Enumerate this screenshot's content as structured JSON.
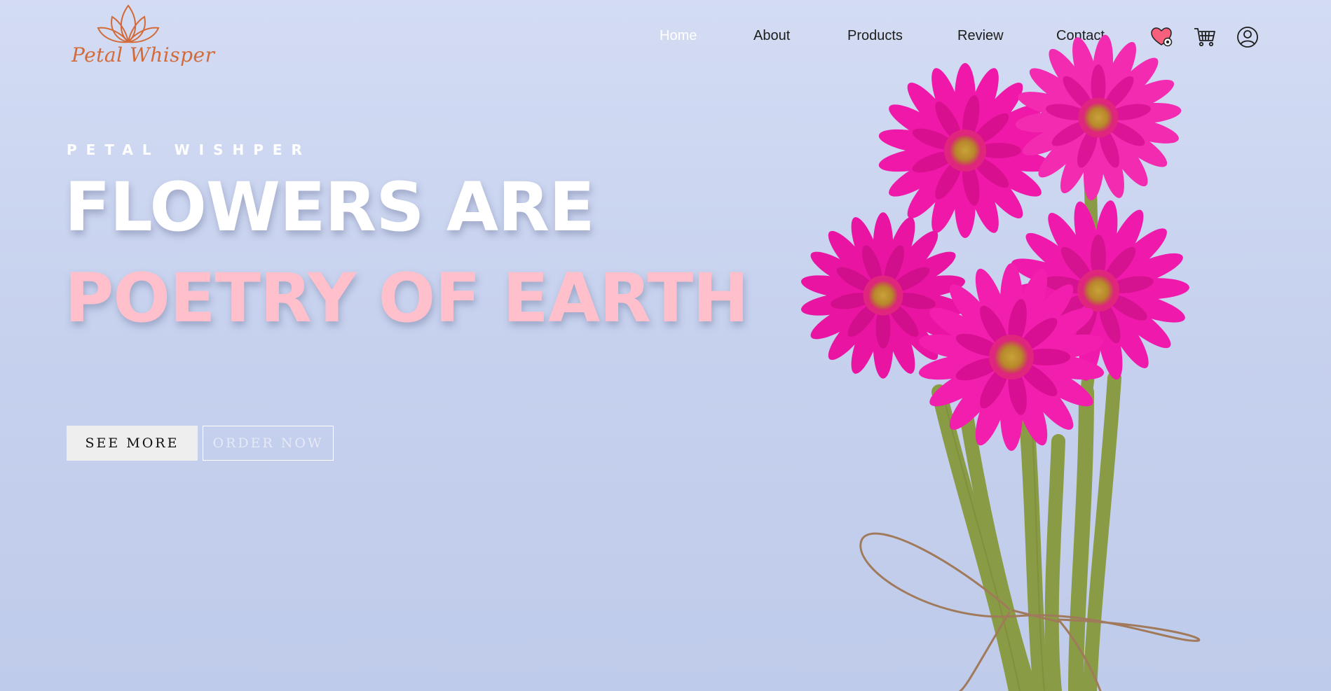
{
  "brand": {
    "name": "Petal Whisper",
    "logo_icon": "lotus-icon",
    "color": "#d26a3a"
  },
  "nav": {
    "items": [
      {
        "label": "Home",
        "active": true
      },
      {
        "label": "About",
        "active": false
      },
      {
        "label": "Products",
        "active": false
      },
      {
        "label": "Review",
        "active": false
      },
      {
        "label": "Contact",
        "active": false
      }
    ],
    "icons": [
      "heart-icon",
      "cart-icon",
      "user-icon"
    ]
  },
  "hero": {
    "eyebrow": "PETAL WISHPER",
    "headline_line1": "FLOWERS ARE",
    "headline_line2": "POETRY OF EARTH",
    "headline_line2_color": "#ffc0cb",
    "primary_button": "SEE MORE",
    "secondary_button": "ORDER NOW"
  },
  "colors": {
    "background": "#c9d3ef",
    "flower": "#f018a8",
    "stem": "#8a9b45"
  }
}
